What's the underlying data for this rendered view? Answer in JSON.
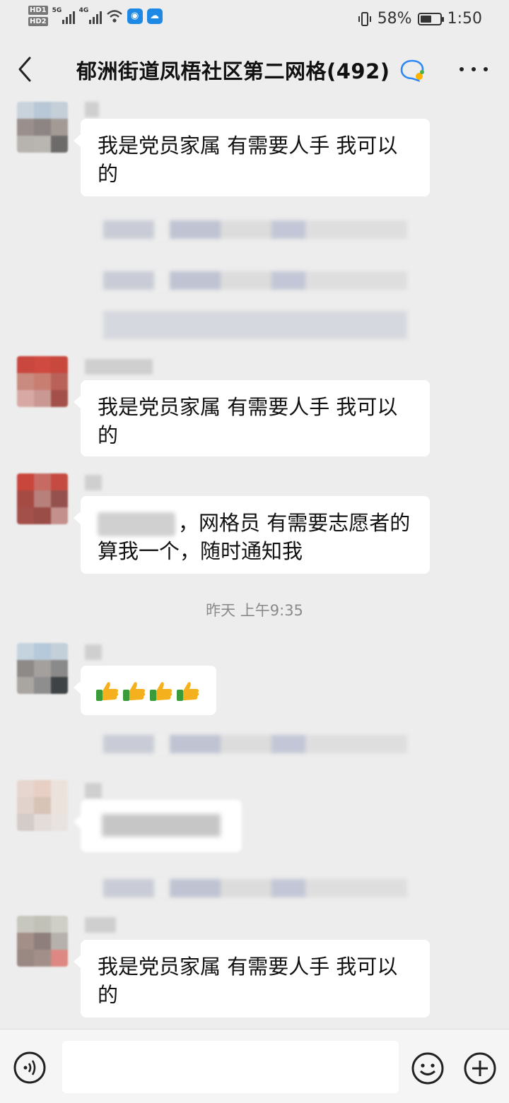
{
  "status_bar": {
    "hd1": "HD1",
    "hd2": "HD2",
    "net1": "5G",
    "net2": "4G",
    "battery_text": "58%",
    "battery_level": 0.58,
    "time": "1:50"
  },
  "header": {
    "title": "郁洲街道凤梧社区第二网格(492)"
  },
  "messages": {
    "m1": "我是党员家属 有需要人手 我可以的",
    "m2": "我是党员家属 有需要人手 我可以的",
    "m3_text": "，网格员  有需要志愿者的算我一个，随时通知我",
    "timestamp": "昨天 上午9:35",
    "m4_emoji": [
      "thumbs-up",
      "thumbs-up",
      "thumbs-up",
      "thumbs-up"
    ],
    "m6": "我是党员家属 有需要人手 我可以的"
  },
  "input_bar": {
    "placeholder": ""
  },
  "colors": {
    "background": "#ededed",
    "bubble": "#ffffff"
  }
}
